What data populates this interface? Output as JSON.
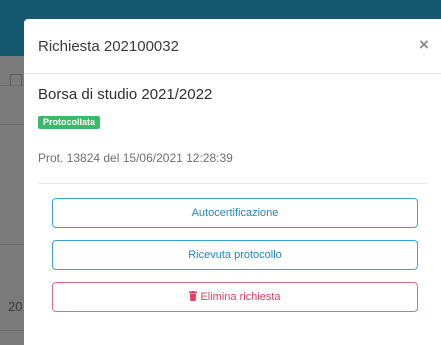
{
  "modal": {
    "title": "Richiesta 202100032",
    "close_symbol": "×",
    "subject": "Borsa di studio 2021/2022",
    "status_badge": "Protocollata",
    "protocol_line": "Prot. 13824 del 15/06/2021 12:28:39",
    "buttons": {
      "autocertificazione": "Autocertificazione",
      "ricevuta": "Ricevuta protocollo",
      "elimina": "Elimina richiesta"
    }
  },
  "background": {
    "partial_number": "20"
  },
  "icons": {
    "close": "close-icon",
    "trash": "trash-icon"
  },
  "colors": {
    "header_bg": "#16586f",
    "badge_green": "#3bb86a",
    "primary_blue": "#1f86c2",
    "danger_red": "#d8425f"
  }
}
